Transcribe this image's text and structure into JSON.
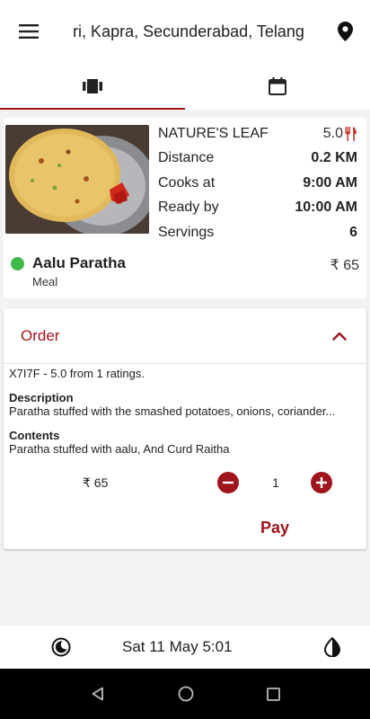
{
  "header": {
    "location": "ri, Kapra, Secunderabad, Telang",
    "menu_icon": "hamburger-menu-icon",
    "pin_icon": "location-pin-icon"
  },
  "tabs": [
    {
      "icon": "film-strip-icon",
      "active": true
    },
    {
      "icon": "calendar-icon",
      "active": false
    }
  ],
  "item": {
    "kitchen": "NATURE'S LEAF",
    "rating": "5.0",
    "rating_icon": "fork-knife-icon",
    "distance_label": "Distance",
    "distance": "0.2 KM",
    "cooks_label": "Cooks at",
    "cooks_at": "9:00 AM",
    "ready_label": "Ready by",
    "ready_by": "10:00 AM",
    "servings_label": "Servings",
    "servings": "6",
    "dish_name": "Aalu Paratha",
    "dish_type": "Meal",
    "price": "₹ 65"
  },
  "order": {
    "title": "Order",
    "ratings": "X7I7F - 5.0 from 1 ratings.",
    "description_label": "Description",
    "description": "Paratha stuffed with the smashed potatoes, onions,  coriander...",
    "contents_label": "Contents",
    "contents": "Paratha stuffed with aalu, And Curd Raitha",
    "price": "₹ 65",
    "quantity": "1",
    "pay_label": "Pay"
  },
  "footer": {
    "date": "Sat 11 May  5:01"
  },
  "colors": {
    "accent": "#a0141c",
    "veg": "#3fb94a"
  }
}
